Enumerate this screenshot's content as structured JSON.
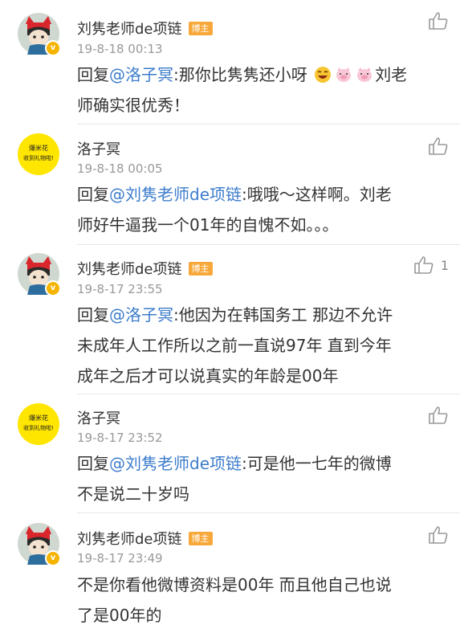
{
  "comments": [
    {
      "name": "刘隽老师de项链",
      "tag": "博主",
      "time": "19-8-18 00:13",
      "reply_prefix": "回复",
      "mention": "@洛子冥",
      "text_a": ":那你比隽隽还小呀",
      "text_b": "刘老",
      "text_c": "师确实很优秀！",
      "emojis": [
        "laughing-emoji",
        "pig-emoji",
        "pig-emoji"
      ]
    },
    {
      "name": "洛子冥",
      "avatar_text_1": "爆米花",
      "avatar_text_2": "收到礼物啦!",
      "time": "19-8-18 00:05",
      "reply_prefix": "回复",
      "mention": "@刘隽老师de项链",
      "text_a": ":哦哦～这样啊。刘老",
      "text_b": "师好牛逼我一个01年的自愧不如。。。"
    },
    {
      "name": "刘隽老师de项链",
      "tag": "博主",
      "time": "19-8-17 23:55",
      "like_count": "1",
      "reply_prefix": "回复",
      "mention": "@洛子冥",
      "text_a": ":他因为在韩国务工 那边不允许",
      "text_b": "未成年人工作所以之前一直说97年 直到今年",
      "text_c": "成年之后才可以说真实的年龄是00年"
    },
    {
      "name": "洛子冥",
      "avatar_text_1": "爆米花",
      "avatar_text_2": "收到礼物啦!",
      "time": "19-8-17 23:52",
      "reply_prefix": "回复",
      "mention": "@刘隽老师de项链",
      "text_a": ":可是他一七年的微博",
      "text_b": "不是说二十岁吗"
    },
    {
      "name": "刘隽老师de项链",
      "tag": "博主",
      "time": "19-8-17 23:49",
      "text_a": "不是你看他微博资料是00年 而且他自己也说",
      "text_b": "了是00年的"
    }
  ],
  "colors": {
    "mention": "#3c7ccc",
    "tag_bg": "#f7a83a",
    "verified_badge": "#f5b400",
    "time": "#999999"
  }
}
